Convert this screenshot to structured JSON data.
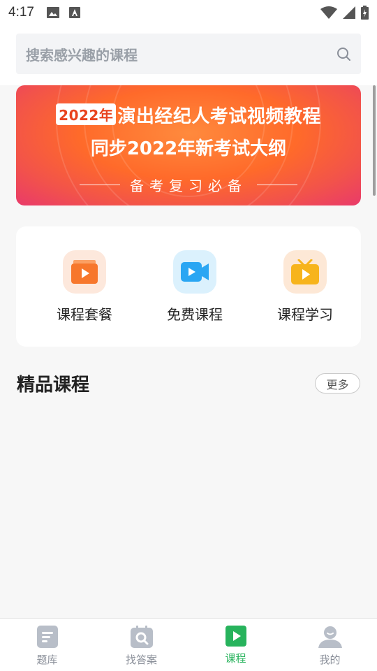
{
  "status_bar": {
    "time": "4:17"
  },
  "search": {
    "placeholder": "搜索感兴趣的课程"
  },
  "banner": {
    "year_tag": "2022年",
    "line1": "演出经纪人考试视频教程",
    "line2": "同步2022年新考试大纲",
    "line3": "备考复习必备"
  },
  "quick_links": [
    {
      "label": "课程套餐",
      "icon": "course-package-icon",
      "color": "#f7772c",
      "bg": "#fde8dc"
    },
    {
      "label": "免费课程",
      "icon": "free-course-video-icon",
      "color": "#2aa6f3",
      "bg": "#dbf1fd"
    },
    {
      "label": "课程学习",
      "icon": "course-study-tv-icon",
      "color": "#f7b41c",
      "bg": "#fde8d6"
    }
  ],
  "section": {
    "title": "精品课程",
    "more_label": "更多"
  },
  "bottom_nav": [
    {
      "label": "题库",
      "icon": "question-bank-icon",
      "active": false
    },
    {
      "label": "找答案",
      "icon": "find-answer-icon",
      "active": false
    },
    {
      "label": "课程",
      "icon": "course-play-icon",
      "active": true
    },
    {
      "label": "我的",
      "icon": "profile-icon",
      "active": false
    }
  ],
  "colors": {
    "accent": "#27b35c",
    "inactive": "#8a8f99"
  }
}
